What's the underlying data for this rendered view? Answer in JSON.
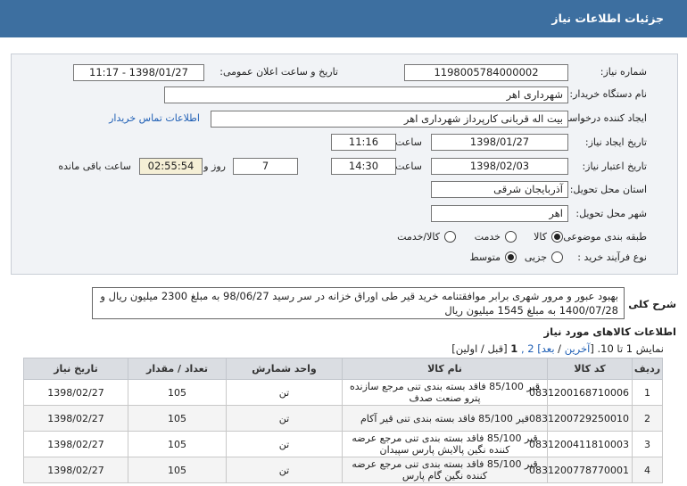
{
  "page": {
    "title": "جزئیات اطلاعات نیاز"
  },
  "form": {
    "need_number_label": "شماره نیاز:",
    "need_number": "1198005784000002",
    "announce_label": "تاریخ و ساعت اعلان عمومی:",
    "announce_value": "1398/01/27 - 11:17",
    "buyer_org_label": "نام دستگاه خریدار:",
    "buyer_org": "شهرداری اهر",
    "requester_label": "ایجاد کننده درخواست:",
    "requester": "بیت اله قربانی کارپرداز شهرداری اهر",
    "contact_link": "اطلاعات تماس خریدار",
    "created_label": "تاریخ ایجاد نیاز:",
    "created_date": "1398/01/27",
    "time_label": "ساعت",
    "created_time": "11:16",
    "validity_label": "تاریخ اعتبار نیاز:",
    "validity_date": "1398/02/03",
    "validity_time": "14:30",
    "days_and": "روز و",
    "days": "7",
    "remaining_time": "02:55:54",
    "remaining_label": "ساعت باقی مانده",
    "province_label": "استان محل تحویل:",
    "province": "آذربایجان شرقی",
    "city_label": "شهر محل تحویل:",
    "city": "اهر",
    "category_label": "طبقه بندی موضوعی:",
    "category_options": [
      "کالا",
      "خدمت",
      "کالا/خدمت"
    ],
    "process_label": "نوع فرآیند خرید :",
    "process_options": [
      "جزیی",
      "متوسط"
    ]
  },
  "summary": {
    "label": "شرح کلی نیاز:",
    "text": "بهبود عبور و مرور شهری برابر موافقتنامه خرید قیر طی اوراق خزانه در سر رسید 98/06/27 به مبلغ 2300 میلیون ریال و 1400/07/28 به مبلغ 1545 میلیون ریال"
  },
  "goods": {
    "heading": "اطلاعات کالاهای مورد نیاز",
    "pager_prefix": "نمایش 1 تا 10. [",
    "pager_last": "آخرین",
    "pager_sep1": " / ",
    "pager_next": "بعد",
    "pager_mid": "] 2 ,",
    "pager_current": "1",
    "pager_suffix": " [قبل / اولین]",
    "columns": [
      "ردیف",
      "کد کالا",
      "نام کالا",
      "واحد شمارش",
      "تعداد / مقدار",
      "تاریخ نیاز"
    ],
    "rows": [
      {
        "idx": "1",
        "code": "0831200168710006",
        "name": "قیر 85/100 فاقد بسته بندی تنی مرجع سازنده پترو صنعت صدف",
        "unit": "تن",
        "qty": "105",
        "date": "1398/02/27"
      },
      {
        "idx": "2",
        "code": "0831200729250010",
        "name": "قیر 85/100 فاقد بسته بندی تنی قیر آکام",
        "unit": "تن",
        "qty": "105",
        "date": "1398/02/27"
      },
      {
        "idx": "3",
        "code": "0831200411810003",
        "name": "قیر 85/100 فاقد بسته بندی تنی مرجع عرضه کننده نگین پالایش پارس سپیدان",
        "unit": "تن",
        "qty": "105",
        "date": "1398/02/27"
      },
      {
        "idx": "4",
        "code": "0831200778770001",
        "name": "قیر 85/100 فاقد بسته بندی تنی مرجع عرضه کننده نگین گام پارس",
        "unit": "تن",
        "qty": "105",
        "date": "1398/02/27"
      }
    ]
  }
}
